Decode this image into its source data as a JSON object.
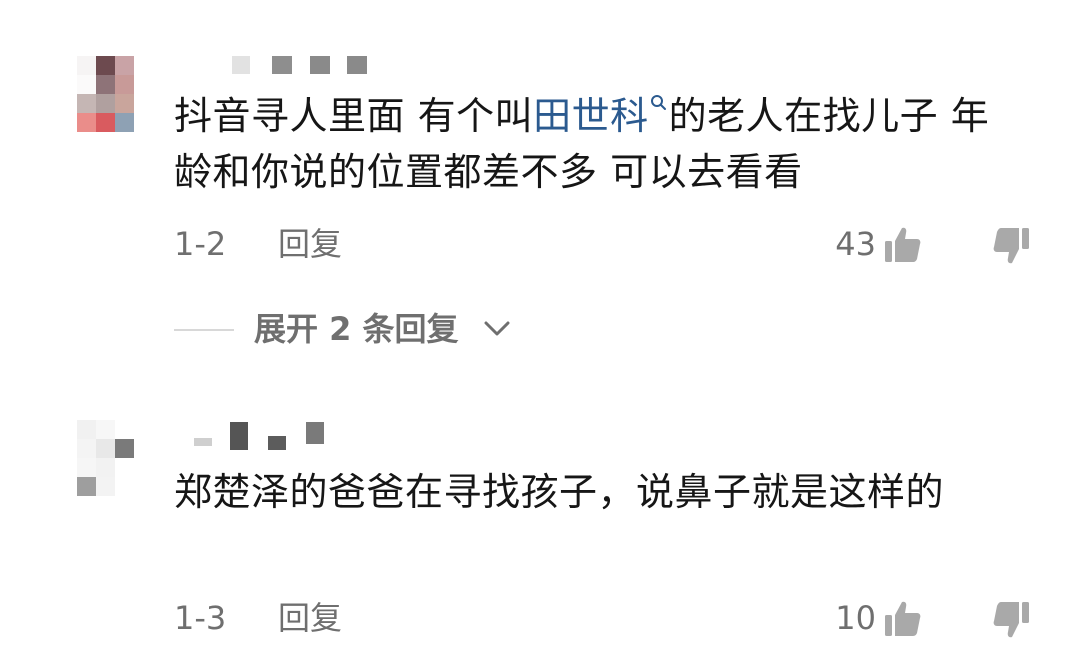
{
  "comments": [
    {
      "text_before": "抖音寻人里面 有个叫",
      "link_text": "田世科",
      "text_after": "的老人在找儿子 年龄和你说的位置都差不多 可以去看看",
      "date": "1-2",
      "reply_label": "回复",
      "likes": "43"
    },
    {
      "text": "郑楚泽的爸爸在寻找孩子，说鼻子就是这样的",
      "date": "1-3",
      "reply_label": "回复",
      "likes": "10"
    }
  ],
  "expand": {
    "label": "展开 2 条回复"
  },
  "colors": {
    "text": "#161616",
    "meta": "#6f6f6f",
    "link": "#2b5a8f",
    "icon": "#a9a9a9"
  },
  "icons": {
    "like": "thumbs-up-icon",
    "dislike": "thumbs-down-icon",
    "search": "search-icon",
    "expand": "chevron-down-icon"
  }
}
